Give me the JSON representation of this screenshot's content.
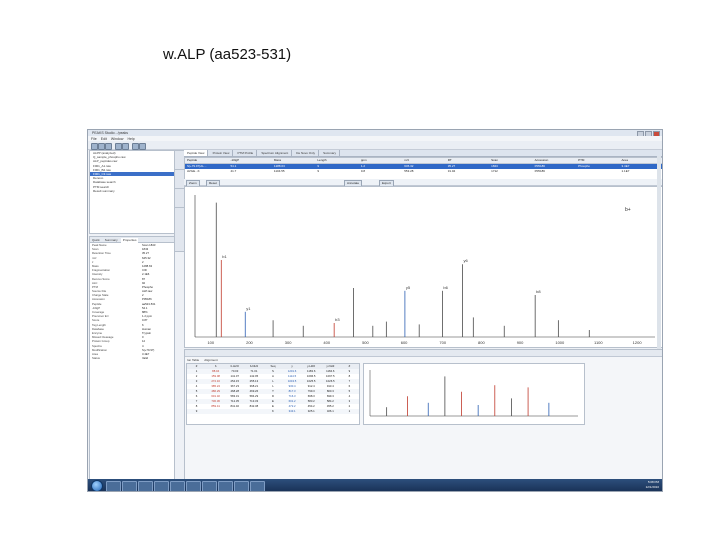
{
  "slide": {
    "title": "w.ALP (aa523-531)"
  },
  "app": {
    "window_title": "PEAKS Studio - /peaks",
    "menu": [
      "File",
      "Edit",
      "Window",
      "Help"
    ],
    "toolbar_icons": [
      "new-icon",
      "open-icon",
      "save-icon",
      "undo-icon",
      "redo-icon",
      "settings-icon",
      "search-icon"
    ]
  },
  "project_tree": {
    "rows": [
      "ALPP (analyzed)",
      "Q_sample_phospho.raw",
      "ALP_peptides.raw",
      "F001_A1.raw",
      "F001_B2.raw",
      "F001_C3.raw",
      "Denovo",
      "Database search",
      "PTM search",
      "Result summary"
    ],
    "selected_index": 5
  },
  "properties_panel": {
    "tabs": [
      "Quick",
      "Summary",
      "Properties"
    ],
    "active_tab": 2,
    "rows": [
      {
        "k": "Peak Name",
        "v": "Scan 1843"
      },
      {
        "k": "Scan",
        "v": "1843"
      },
      {
        "k": "Retention Time",
        "v": "35.27"
      },
      {
        "k": "m/z",
        "v": "645.32"
      },
      {
        "k": "z",
        "v": "2"
      },
      {
        "k": "Mass",
        "v": "1288.63"
      },
      {
        "k": "Fragmentation",
        "v": "CID"
      },
      {
        "k": "Intensity",
        "v": "2.1E6"
      },
      {
        "k": "Denovo Score",
        "v": "87"
      },
      {
        "k": "ALC",
        "v": "92"
      },
      {
        "k": "PTM",
        "v": "Phospho"
      },
      {
        "k": "Source File",
        "v": "ALP.raw"
      },
      {
        "k": "Charge State",
        "v": "2"
      },
      {
        "k": "Accession",
        "v": "P05186"
      },
      {
        "k": "Peptide",
        "v": "aa523-531"
      },
      {
        "k": "-10lgP",
        "v": "54.1"
      },
      {
        "k": "Coverage",
        "v": "88%"
      },
      {
        "k": "Precursor Err",
        "v": "1.2 ppm"
      },
      {
        "k": "Score",
        "v": "0.87"
      },
      {
        "k": "Tag Length",
        "v": "6"
      },
      {
        "k": "Database",
        "v": "Human"
      },
      {
        "k": "Enzyme",
        "v": "Trypsin"
      },
      {
        "k": "Missed Cleavage",
        "v": "0"
      },
      {
        "k": "Protein Group",
        "v": "12"
      },
      {
        "k": "Spectra",
        "v": "4"
      },
      {
        "k": "Modification",
        "v": "S(+79.97)"
      },
      {
        "k": "Area",
        "v": "3.4E7"
      },
      {
        "k": "Status",
        "v": "Valid"
      }
    ]
  },
  "editor_tabs": [
    "Peptide View",
    "Protein View",
    "PTM Profile",
    "Spectrum Alignment",
    "De Novo Only",
    "Summary"
  ],
  "psm_table": {
    "headers": [
      "Peptide",
      "-10lgP",
      "Mass",
      "Length",
      "ppm",
      "m/z",
      "RT",
      "Scan",
      "Accession",
      "PTM",
      "Area"
    ],
    "rows": [
      [
        "S(+79.97)AL...",
        "54.1",
        "1288.63",
        "9",
        "1.2",
        "645.32",
        "35.27",
        "1843",
        "P05186",
        "Phospho",
        "3.4E7"
      ],
      [
        "AVGE...K",
        "41.7",
        "1104.55",
        "9",
        "0.8",
        "553.28",
        "31.04",
        "1712",
        "P05186",
        "",
        "1.1E7"
      ]
    ],
    "selected_row": 0
  },
  "spectrum_toolbar": {
    "buttons": [
      "Zoom",
      "Reset",
      "Annotate",
      "Export"
    ]
  },
  "spectrum_axis": {
    "ticks": [
      "100",
      "200",
      "300",
      "400",
      "500",
      "600",
      "700",
      "800",
      "900",
      "1000",
      "1100",
      "1200"
    ]
  },
  "spectrum_peaks": [
    {
      "mz": 115,
      "rel": 0.96,
      "color": "#4a4a4a",
      "label": ""
    },
    {
      "mz": 128,
      "rel": 0.55,
      "color": "#c0392b",
      "label": "b1"
    },
    {
      "mz": 190,
      "rel": 0.18,
      "color": "#2b5fb3",
      "label": "y1"
    },
    {
      "mz": 262,
      "rel": 0.12,
      "color": "#4a4a4a",
      "label": ""
    },
    {
      "mz": 340,
      "rel": 0.08,
      "color": "#4a4a4a",
      "label": ""
    },
    {
      "mz": 420,
      "rel": 0.1,
      "color": "#c0392b",
      "label": "b3"
    },
    {
      "mz": 470,
      "rel": 0.35,
      "color": "#4a4a4a",
      "label": ""
    },
    {
      "mz": 520,
      "rel": 0.08,
      "color": "#4a4a4a",
      "label": ""
    },
    {
      "mz": 555,
      "rel": 0.11,
      "color": "#4a4a4a",
      "label": ""
    },
    {
      "mz": 603,
      "rel": 0.33,
      "color": "#2b5fb3",
      "label": "y5"
    },
    {
      "mz": 640,
      "rel": 0.09,
      "color": "#4a4a4a",
      "label": ""
    },
    {
      "mz": 700,
      "rel": 0.33,
      "color": "#4a4a4a",
      "label": "b6"
    },
    {
      "mz": 752,
      "rel": 0.52,
      "color": "#4a4a4a",
      "label": "y6"
    },
    {
      "mz": 780,
      "rel": 0.14,
      "color": "#4a4a4a",
      "label": ""
    },
    {
      "mz": 860,
      "rel": 0.08,
      "color": "#4a4a4a",
      "label": ""
    },
    {
      "mz": 940,
      "rel": 0.3,
      "color": "#4a4a4a",
      "label": "b8"
    },
    {
      "mz": 1000,
      "rel": 0.12,
      "color": "#4a4a4a",
      "label": ""
    },
    {
      "mz": 1080,
      "rel": 0.05,
      "color": "#4a4a4a",
      "label": ""
    }
  ],
  "top_label": "b+",
  "bottom_pane": {
    "toolbar_label": "Ion Table",
    "tabs": [
      "Ion Table",
      "Alignment"
    ],
    "frag_headers": [
      "#",
      "b",
      "b-H2O",
      "b-NH3",
      "Seq",
      "y",
      "y-H2O",
      "y-NH3",
      "#"
    ],
    "frag_rows": [
      [
        "1",
        "88.04",
        "70.03",
        "71.01",
        "S",
        "1201.6",
        "1183.6",
        "1184.6",
        "9"
      ],
      [
        "2",
        "159.08",
        "141.07",
        "142.05",
        "A",
        "1114.5",
        "1096.5",
        "1097.5",
        "8"
      ],
      [
        "3",
        "272.16",
        "254.15",
        "255.13",
        "L",
        "1043.5",
        "1025.5",
        "1026.5",
        "7"
      ],
      [
        "4",
        "385.24",
        "367.23",
        "368.21",
        "L",
        "930.4",
        "912.4",
        "913.4",
        "6"
      ],
      [
        "5",
        "486.29",
        "468.28",
        "469.26",
        "T",
        "817.3",
        "799.3",
        "800.3",
        "5"
      ],
      [
        "6",
        "601.32",
        "583.31",
        "584.29",
        "D",
        "716.3",
        "698.3",
        "699.3",
        "4"
      ],
      [
        "7",
        "730.36",
        "712.35",
        "713.33",
        "E",
        "601.2",
        "583.2",
        "584.2",
        "3"
      ],
      [
        "8",
        "859.41",
        "841.40",
        "842.38",
        "E",
        "472.2",
        "454.2",
        "455.2",
        "2"
      ],
      [
        "9",
        "",
        "",
        "",
        "K",
        "343.1",
        "325.1",
        "326.1",
        "1"
      ]
    ]
  },
  "mini_spectrum_peaks": [
    {
      "x": 0.08,
      "rel": 0.2,
      "color": "#4a4a4a"
    },
    {
      "x": 0.18,
      "rel": 0.45,
      "color": "#c0392b"
    },
    {
      "x": 0.28,
      "rel": 0.3,
      "color": "#2b5fb3"
    },
    {
      "x": 0.36,
      "rel": 0.9,
      "color": "#4a4a4a"
    },
    {
      "x": 0.44,
      "rel": 0.55,
      "color": "#c0392b"
    },
    {
      "x": 0.52,
      "rel": 0.25,
      "color": "#2b5fb3"
    },
    {
      "x": 0.6,
      "rel": 0.7,
      "color": "#c0392b"
    },
    {
      "x": 0.68,
      "rel": 0.4,
      "color": "#4a4a4a"
    },
    {
      "x": 0.76,
      "rel": 0.65,
      "color": "#c0392b"
    },
    {
      "x": 0.86,
      "rel": 0.3,
      "color": "#2b5fb3"
    }
  ],
  "taskbar": {
    "apps": [
      "explorer",
      "ie",
      "folder",
      "media",
      "peaks",
      "paint",
      "word",
      "excel",
      "pdf",
      "app"
    ],
    "time": "5:08 PM",
    "date": "12/1/2010"
  }
}
